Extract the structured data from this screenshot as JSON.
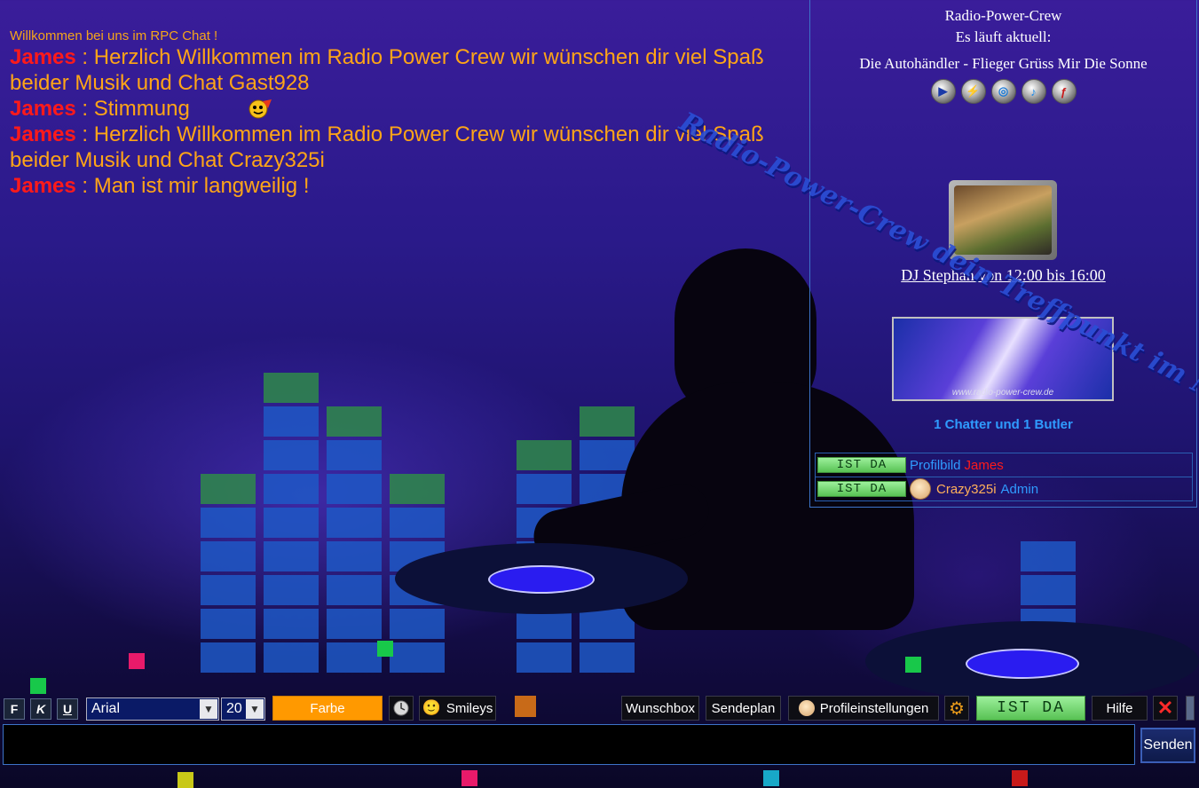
{
  "chat": {
    "welcome": "Willkommen bei uns im RPC Chat !",
    "messages": [
      {
        "nick": "James",
        "sep": " : ",
        "text": "Herzlich Willkommen im Radio Power Crew wir wünschen dir viel Spaß beider Musik und Chat Gast928"
      },
      {
        "nick": "James",
        "sep": " : ",
        "text": "Stimmung"
      },
      {
        "nick": "James",
        "sep": " : ",
        "text": "Herzlich Willkommen im Radio Power Crew wir wünschen dir viel Spaß beider Musik und Chat Crazy325i"
      },
      {
        "nick": "James",
        "sep": " : ",
        "text": "Man ist mir langweilig !"
      }
    ]
  },
  "sidebar": {
    "station": "Radio-Power-Crew",
    "now_playing_label": "Es läuft aktuell:",
    "song": "Die Autohändler - Flieger Grüss Mir Die Sonne",
    "player_icons": [
      "mediaplayer-icon",
      "winamp-icon",
      "realplayer-icon",
      "itunes-icon",
      "flash-icon"
    ],
    "dj_schedule": "DJ Stephan von 12:00 bis 16:00",
    "banner_text": "www.radio-power-crew.de",
    "slogan": "Radio-Power-Crew dein Treffpunkt im Netz",
    "online_count": "1 Chatter und 1 Butler",
    "users": [
      {
        "status": "IST DA",
        "profile_link": "Profilbild",
        "name": "James"
      },
      {
        "status": "IST DA",
        "name": "Crazy325i",
        "role": "Admin"
      }
    ]
  },
  "toolbar": {
    "bold": "F",
    "italic": "K",
    "underline": "U",
    "font": "Arial",
    "size": "20",
    "color_label": "Farbe",
    "smileys_label": "Smileys",
    "wishbox_label": "Wunschbox",
    "schedule_label": "Sendeplan",
    "profile_settings_label": "Profileinstellungen",
    "status_label": "IST DA",
    "help_label": "Hilfe",
    "close_symbol": "✕"
  },
  "input": {
    "value": "",
    "send_label": "Senden"
  }
}
